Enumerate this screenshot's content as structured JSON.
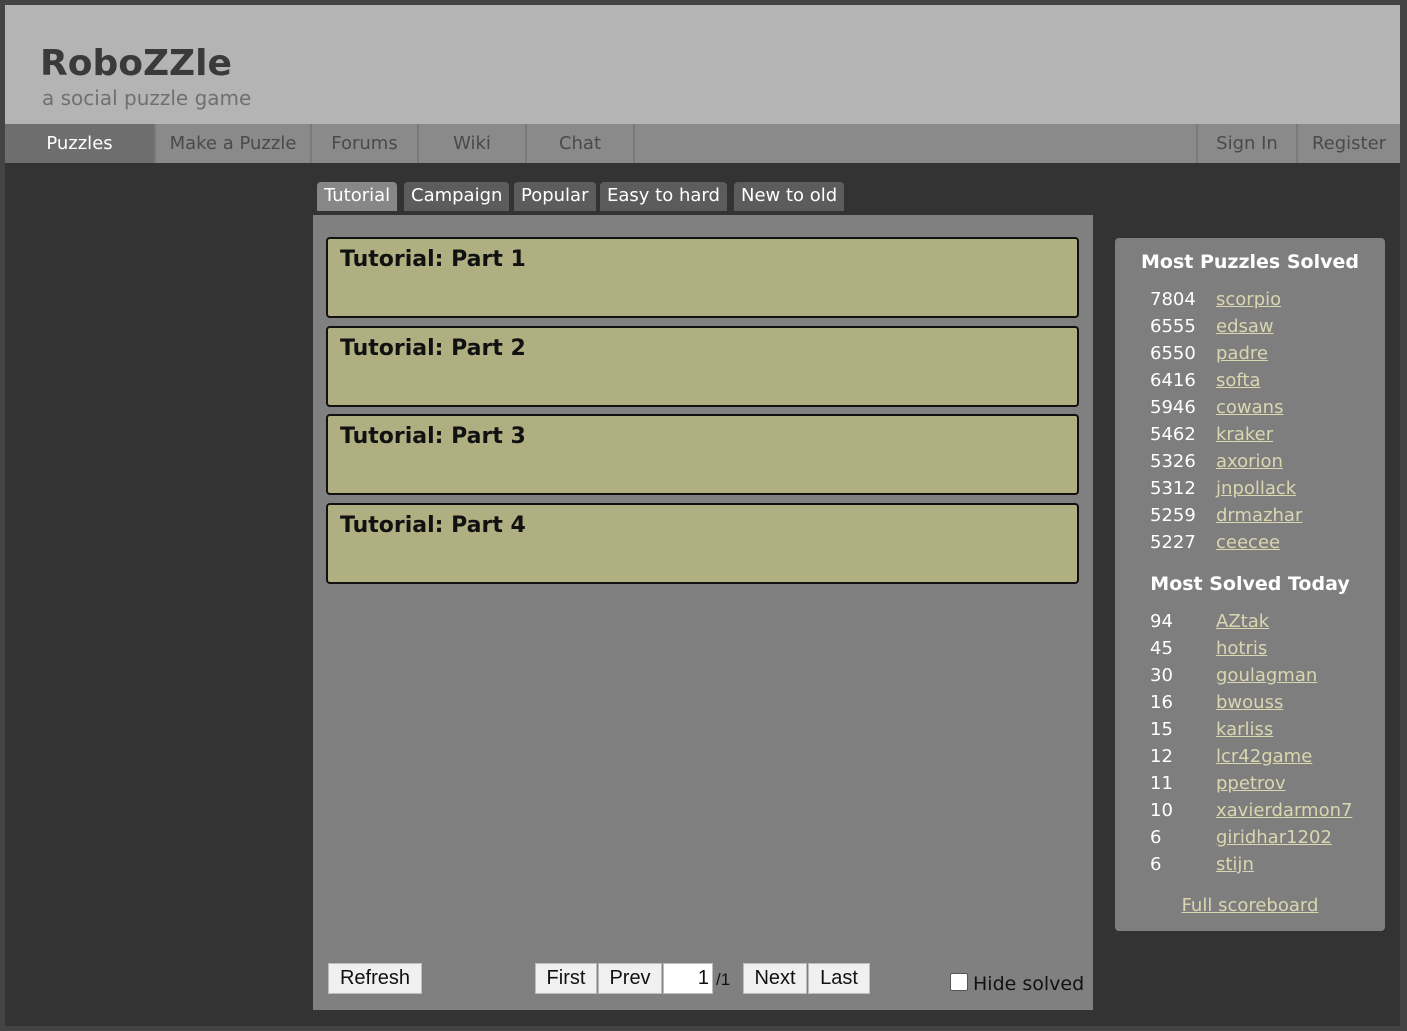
{
  "header": {
    "title": "RoboZZle",
    "subtitle": "a social puzzle game"
  },
  "nav": {
    "left": [
      "Puzzles",
      "Make a Puzzle",
      "Forums",
      "Wiki",
      "Chat"
    ],
    "right": [
      "Sign In",
      "Register"
    ],
    "active": "Puzzles"
  },
  "tabs": {
    "items": [
      "Tutorial",
      "Campaign",
      "Popular",
      "Easy to hard",
      "New to old"
    ],
    "active": "Tutorial"
  },
  "puzzles": [
    {
      "title": "Tutorial: Part 1"
    },
    {
      "title": "Tutorial: Part 2"
    },
    {
      "title": "Tutorial: Part 3"
    },
    {
      "title": "Tutorial: Part 4"
    }
  ],
  "pager": {
    "refresh": "Refresh",
    "first": "First",
    "prev": "Prev",
    "page": "1",
    "total": "/1",
    "next": "Next",
    "last": "Last",
    "hide_solved": "Hide solved",
    "hide_solved_checked": false
  },
  "scoreboard": {
    "most_solved_heading": "Most Puzzles Solved",
    "most_solved": [
      {
        "count": "7804",
        "name": "scorpio"
      },
      {
        "count": "6555",
        "name": "edsaw"
      },
      {
        "count": "6550",
        "name": "padre"
      },
      {
        "count": "6416",
        "name": "softa"
      },
      {
        "count": "5946",
        "name": "cowans"
      },
      {
        "count": "5462",
        "name": "kraker"
      },
      {
        "count": "5326",
        "name": "axorion"
      },
      {
        "count": "5312",
        "name": "jnpollack"
      },
      {
        "count": "5259",
        "name": "drmazhar"
      },
      {
        "count": "5227",
        "name": "ceecee"
      }
    ],
    "today_heading": "Most Solved Today",
    "today": [
      {
        "count": "94",
        "name": "AZtak"
      },
      {
        "count": "45",
        "name": "hotris"
      },
      {
        "count": "30",
        "name": "goulagman"
      },
      {
        "count": "16",
        "name": "bwouss"
      },
      {
        "count": "15",
        "name": "karliss"
      },
      {
        "count": "12",
        "name": "lcr42game"
      },
      {
        "count": "11",
        "name": "ppetrov"
      },
      {
        "count": "10",
        "name": "xavierdarmon7"
      },
      {
        "count": "6",
        "name": "giridhar1202"
      },
      {
        "count": "6",
        "name": "stijn"
      }
    ],
    "full_link": "Full scoreboard"
  },
  "colors": {
    "header_bg": "#b4b4b4",
    "nav_bg": "#8a8a8a",
    "card_bg": "#b0af82",
    "link": "#d9d7b0"
  }
}
